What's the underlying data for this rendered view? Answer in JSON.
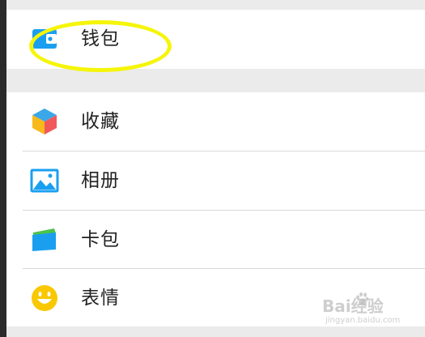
{
  "menu": {
    "wallet": {
      "label": "钱包",
      "icon": "wallet-icon"
    },
    "items": [
      {
        "id": "favorites",
        "label": "收藏",
        "icon": "cube-icon"
      },
      {
        "id": "album",
        "label": "相册",
        "icon": "picture-icon"
      },
      {
        "id": "cards",
        "label": "卡包",
        "icon": "card-holder-icon"
      },
      {
        "id": "stickers",
        "label": "表情",
        "icon": "smiley-icon"
      }
    ]
  },
  "annotation": {
    "color": "#f5f50a"
  },
  "watermark": {
    "main": "Bai经验",
    "sub": "jingyan.baidu.com"
  },
  "colors": {
    "accent_blue": "#1a9ff0",
    "background": "#ebebeb",
    "cube_blue": "#3aa7e8",
    "cube_yellow": "#f7b91b",
    "cube_red": "#f0585a",
    "card_green": "#4cc24c",
    "smiley_yellow": "#f9c800"
  }
}
